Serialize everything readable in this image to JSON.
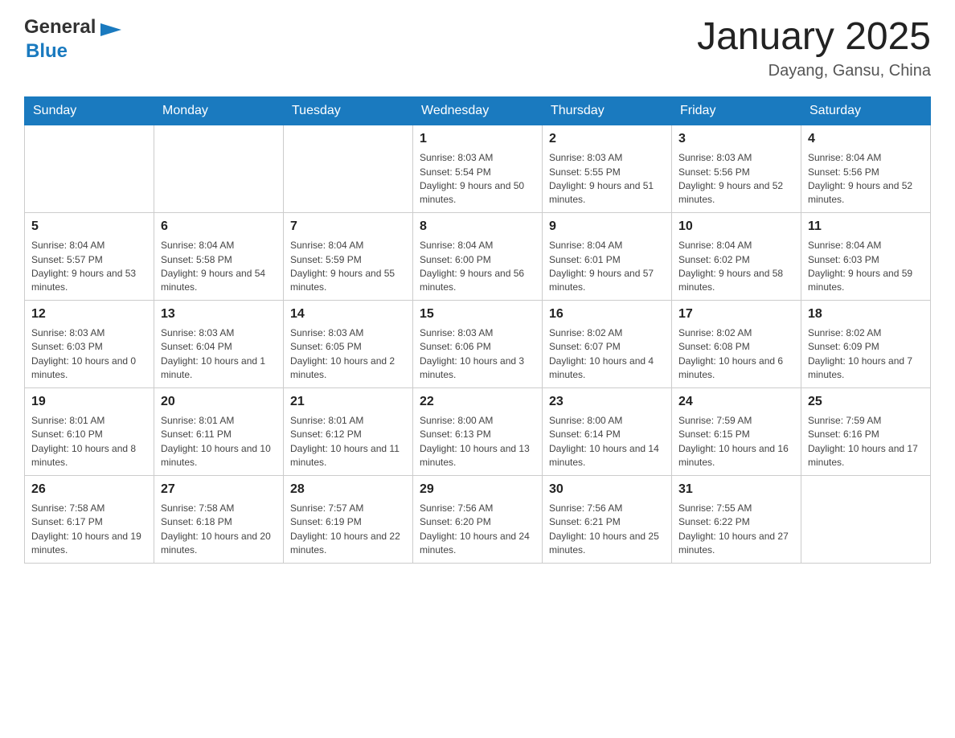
{
  "header": {
    "logo_general": "General",
    "logo_blue": "Blue",
    "month_title": "January 2025",
    "location": "Dayang, Gansu, China"
  },
  "days_of_week": [
    "Sunday",
    "Monday",
    "Tuesday",
    "Wednesday",
    "Thursday",
    "Friday",
    "Saturday"
  ],
  "weeks": [
    [
      {
        "day": "",
        "info": ""
      },
      {
        "day": "",
        "info": ""
      },
      {
        "day": "",
        "info": ""
      },
      {
        "day": "1",
        "info": "Sunrise: 8:03 AM\nSunset: 5:54 PM\nDaylight: 9 hours and 50 minutes."
      },
      {
        "day": "2",
        "info": "Sunrise: 8:03 AM\nSunset: 5:55 PM\nDaylight: 9 hours and 51 minutes."
      },
      {
        "day": "3",
        "info": "Sunrise: 8:03 AM\nSunset: 5:56 PM\nDaylight: 9 hours and 52 minutes."
      },
      {
        "day": "4",
        "info": "Sunrise: 8:04 AM\nSunset: 5:56 PM\nDaylight: 9 hours and 52 minutes."
      }
    ],
    [
      {
        "day": "5",
        "info": "Sunrise: 8:04 AM\nSunset: 5:57 PM\nDaylight: 9 hours and 53 minutes."
      },
      {
        "day": "6",
        "info": "Sunrise: 8:04 AM\nSunset: 5:58 PM\nDaylight: 9 hours and 54 minutes."
      },
      {
        "day": "7",
        "info": "Sunrise: 8:04 AM\nSunset: 5:59 PM\nDaylight: 9 hours and 55 minutes."
      },
      {
        "day": "8",
        "info": "Sunrise: 8:04 AM\nSunset: 6:00 PM\nDaylight: 9 hours and 56 minutes."
      },
      {
        "day": "9",
        "info": "Sunrise: 8:04 AM\nSunset: 6:01 PM\nDaylight: 9 hours and 57 minutes."
      },
      {
        "day": "10",
        "info": "Sunrise: 8:04 AM\nSunset: 6:02 PM\nDaylight: 9 hours and 58 minutes."
      },
      {
        "day": "11",
        "info": "Sunrise: 8:04 AM\nSunset: 6:03 PM\nDaylight: 9 hours and 59 minutes."
      }
    ],
    [
      {
        "day": "12",
        "info": "Sunrise: 8:03 AM\nSunset: 6:03 PM\nDaylight: 10 hours and 0 minutes."
      },
      {
        "day": "13",
        "info": "Sunrise: 8:03 AM\nSunset: 6:04 PM\nDaylight: 10 hours and 1 minute."
      },
      {
        "day": "14",
        "info": "Sunrise: 8:03 AM\nSunset: 6:05 PM\nDaylight: 10 hours and 2 minutes."
      },
      {
        "day": "15",
        "info": "Sunrise: 8:03 AM\nSunset: 6:06 PM\nDaylight: 10 hours and 3 minutes."
      },
      {
        "day": "16",
        "info": "Sunrise: 8:02 AM\nSunset: 6:07 PM\nDaylight: 10 hours and 4 minutes."
      },
      {
        "day": "17",
        "info": "Sunrise: 8:02 AM\nSunset: 6:08 PM\nDaylight: 10 hours and 6 minutes."
      },
      {
        "day": "18",
        "info": "Sunrise: 8:02 AM\nSunset: 6:09 PM\nDaylight: 10 hours and 7 minutes."
      }
    ],
    [
      {
        "day": "19",
        "info": "Sunrise: 8:01 AM\nSunset: 6:10 PM\nDaylight: 10 hours and 8 minutes."
      },
      {
        "day": "20",
        "info": "Sunrise: 8:01 AM\nSunset: 6:11 PM\nDaylight: 10 hours and 10 minutes."
      },
      {
        "day": "21",
        "info": "Sunrise: 8:01 AM\nSunset: 6:12 PM\nDaylight: 10 hours and 11 minutes."
      },
      {
        "day": "22",
        "info": "Sunrise: 8:00 AM\nSunset: 6:13 PM\nDaylight: 10 hours and 13 minutes."
      },
      {
        "day": "23",
        "info": "Sunrise: 8:00 AM\nSunset: 6:14 PM\nDaylight: 10 hours and 14 minutes."
      },
      {
        "day": "24",
        "info": "Sunrise: 7:59 AM\nSunset: 6:15 PM\nDaylight: 10 hours and 16 minutes."
      },
      {
        "day": "25",
        "info": "Sunrise: 7:59 AM\nSunset: 6:16 PM\nDaylight: 10 hours and 17 minutes."
      }
    ],
    [
      {
        "day": "26",
        "info": "Sunrise: 7:58 AM\nSunset: 6:17 PM\nDaylight: 10 hours and 19 minutes."
      },
      {
        "day": "27",
        "info": "Sunrise: 7:58 AM\nSunset: 6:18 PM\nDaylight: 10 hours and 20 minutes."
      },
      {
        "day": "28",
        "info": "Sunrise: 7:57 AM\nSunset: 6:19 PM\nDaylight: 10 hours and 22 minutes."
      },
      {
        "day": "29",
        "info": "Sunrise: 7:56 AM\nSunset: 6:20 PM\nDaylight: 10 hours and 24 minutes."
      },
      {
        "day": "30",
        "info": "Sunrise: 7:56 AM\nSunset: 6:21 PM\nDaylight: 10 hours and 25 minutes."
      },
      {
        "day": "31",
        "info": "Sunrise: 7:55 AM\nSunset: 6:22 PM\nDaylight: 10 hours and 27 minutes."
      },
      {
        "day": "",
        "info": ""
      }
    ]
  ]
}
